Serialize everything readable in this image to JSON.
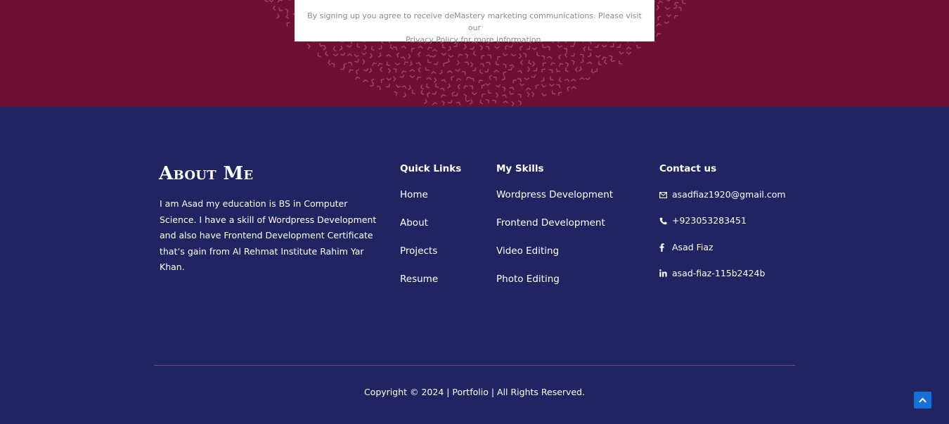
{
  "signup_notice": {
    "line1": "By signing up you agree to receive deMastery marketing communications. Please visit our",
    "line2": "Privacy Policy for more information."
  },
  "about": {
    "title": "About Me",
    "text": "I am Asad my education is BS in Computer Science. I have a skill of  Wordpress Development and also have Frontend Development Certificate that’s gain from Al Rehmat Institute Rahim Yar Khan."
  },
  "quick_links": {
    "title": "Quick Links",
    "items": [
      {
        "label": "Home"
      },
      {
        "label": "About"
      },
      {
        "label": "Projects"
      },
      {
        "label": "Resume"
      }
    ]
  },
  "skills": {
    "title": "My Skills",
    "items": [
      {
        "label": "Wordpress Development"
      },
      {
        "label": "Frontend Development"
      },
      {
        "label": "Video Editing"
      },
      {
        "label": "Photo Editing"
      }
    ]
  },
  "contact": {
    "title": "Contact us",
    "items": [
      {
        "icon": "envelope-icon",
        "text": "asadfiaz1920@gmail.com"
      },
      {
        "icon": "phone-icon",
        "text": "+923053283451"
      },
      {
        "icon": "facebook-icon",
        "text": "Asad Fiaz"
      },
      {
        "icon": "linkedin-icon",
        "text": "asad-fiaz-115b2424b"
      }
    ]
  },
  "copyright": "Copyright © 2024 | Portfolio | All Rights Reserved.",
  "colors": {
    "top_band": "#6e1034",
    "pattern": "#a8406a",
    "footer_bg": "#202460",
    "divider": "#c2286a",
    "scroll_button": "#1770d6"
  }
}
